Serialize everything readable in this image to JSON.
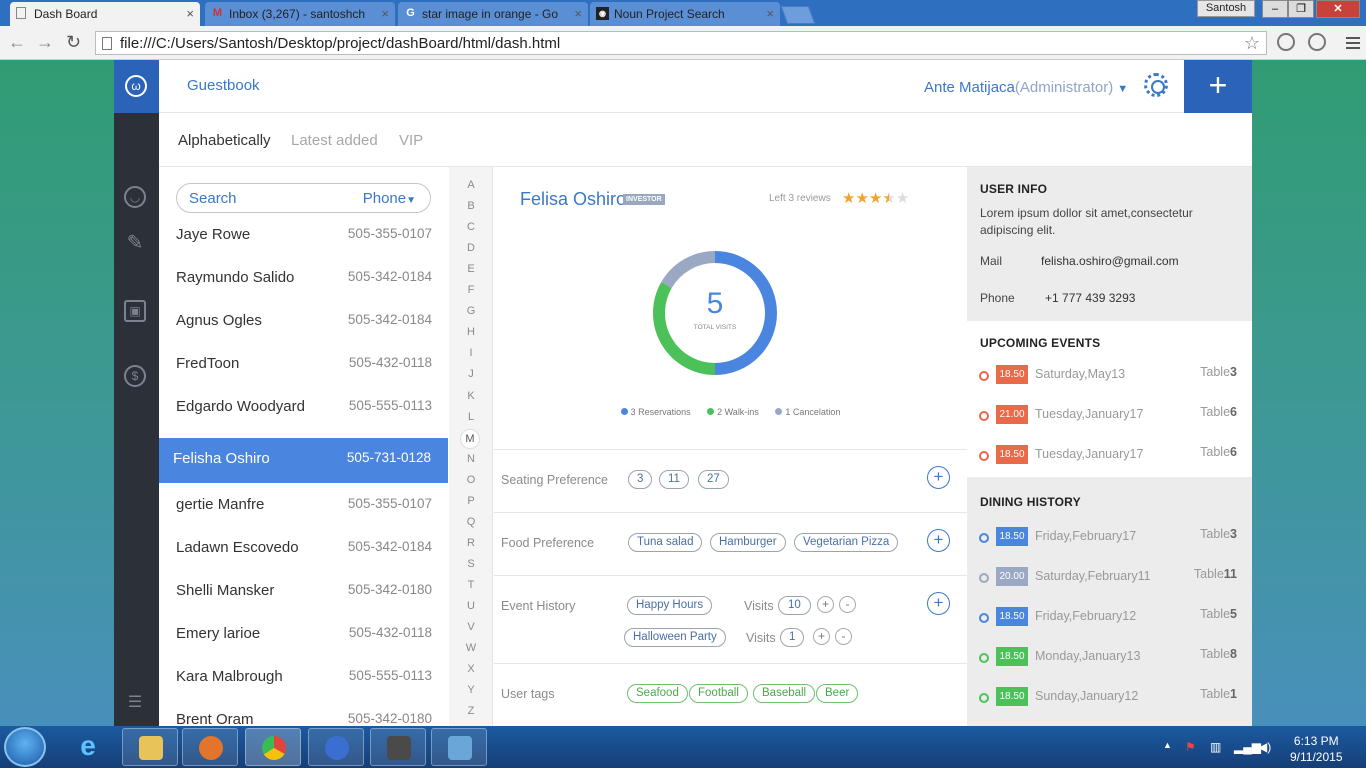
{
  "browser": {
    "tabs": [
      {
        "title": "Dash Board",
        "favicon": "page-icon"
      },
      {
        "title": "Inbox (3,267) - santoshch",
        "favicon": "gmail-icon"
      },
      {
        "title": "star image in orange - Go",
        "favicon": "google-icon"
      },
      {
        "title": "Noun Project Search",
        "favicon": "noun-project-icon"
      }
    ],
    "profile": "Santosh",
    "url": "file:///C:/Users/Santosh/Desktop/project/dashBoard/html/dash.html"
  },
  "header": {
    "section": "Guestbook",
    "user_name": "Ante Matijaca",
    "user_role": "(Administrator)"
  },
  "filters": [
    "Alphabetically",
    "Latest added",
    "VIP"
  ],
  "search": {
    "placeholder": "Search",
    "field": "Phone"
  },
  "guests": [
    {
      "name": "Jaye Rowe",
      "phone": "505-355-0107"
    },
    {
      "name": "Raymundo Salido",
      "phone": "505-342-0184"
    },
    {
      "name": "Agnus Ogles",
      "phone": "505-342-0184"
    },
    {
      "name": "FredToon",
      "phone": "505-432-0118"
    },
    {
      "name": "Edgardo Woodyard",
      "phone": "505-555-0113"
    },
    {
      "name": "Felisha Oshiro",
      "phone": "505-731-0128",
      "selected": true
    },
    {
      "name": "gertie Manfre",
      "phone": "505-355-0107"
    },
    {
      "name": "Ladawn Escovedo",
      "phone": "505-342-0184"
    },
    {
      "name": "Shelli Mansker",
      "phone": "505-342-0180"
    },
    {
      "name": "Emery larioe",
      "phone": "505-432-0118"
    },
    {
      "name": "Kara Malbrough",
      "phone": "505-555-0113"
    },
    {
      "name": "Brent Oram",
      "phone": "505-342-0180"
    }
  ],
  "alphabet": [
    "A",
    "B",
    "C",
    "D",
    "E",
    "F",
    "G",
    "H",
    "I",
    "J",
    "K",
    "L",
    "M",
    "N",
    "O",
    "P",
    "Q",
    "R",
    "S",
    "T",
    "U",
    "V",
    "W",
    "X",
    "Y",
    "Z"
  ],
  "alphabet_active": "M",
  "profile": {
    "name": "Felisa Oshiro",
    "badge": "INVESTOR",
    "reviews": "Left 3 reviews",
    "rating": 3.5,
    "rating_max": 5,
    "visits_total": "5",
    "visits_label": "TOTAL VISITS",
    "legend": [
      {
        "label": "3 Reservations",
        "count": 3,
        "color": "#4a86e0"
      },
      {
        "label": "2 Walk-ins",
        "count": 2,
        "color": "#4cc15a"
      },
      {
        "label": "1 Cancelation",
        "count": 1,
        "color": "#9aa8c4"
      }
    ],
    "seating_label": "Seating Preference",
    "seating": [
      "3",
      "11",
      "27"
    ],
    "food_label": "Food Preference",
    "food": [
      "Tuna salad",
      "Hamburger",
      "Vegetarian Pizza"
    ],
    "event_label": "Event History",
    "events": [
      {
        "name": "Happy Hours",
        "visits_label": "Visits",
        "visits": "10"
      },
      {
        "name": "Halloween Party",
        "visits_label": "Visits",
        "visits": "1"
      }
    ],
    "tags_label": "User tags",
    "tags": [
      "Seafood",
      "Football",
      "Baseball",
      "Beer"
    ]
  },
  "user_info": {
    "title": "USER INFO",
    "description": "Lorem ipsum dollor sit amet,consectetur adipiscing elit.",
    "mail_label": "Mail",
    "mail": "felisha.oshiro@gmail.com",
    "phone_label": "Phone",
    "phone": "+1 777 439 3293"
  },
  "upcoming": {
    "title": "UPCOMING EVENTS",
    "items": [
      {
        "time": "18.50",
        "date": "Saturday,May13",
        "table_label": "Table",
        "table": "3",
        "color": "#e86a4a"
      },
      {
        "time": "21.00",
        "date": "Tuesday,January17",
        "table_label": "Table",
        "table": "6",
        "color": "#e86a4a"
      },
      {
        "time": "18.50",
        "date": "Tuesday,January17",
        "table_label": "Table",
        "table": "6",
        "color": "#e86a4a"
      }
    ]
  },
  "dining": {
    "title": "DINING HISTORY",
    "items": [
      {
        "time": "18.50",
        "date": "Friday,February17",
        "table_label": "Table",
        "table": "3",
        "color": "#4a86e0"
      },
      {
        "time": "20.00",
        "date": "Saturday,February11",
        "table_label": "Table",
        "table": "11",
        "color": "#9aa8c4"
      },
      {
        "time": "18.50",
        "date": "Friday,February12",
        "table_label": "Table",
        "table": "5",
        "color": "#4a86e0"
      },
      {
        "time": "18.50",
        "date": "Monday,January13",
        "table_label": "Table",
        "table": "8",
        "color": "#4cc15a"
      },
      {
        "time": "18.50",
        "date": "Sunday,January12",
        "table_label": "Table",
        "table": "1",
        "color": "#4cc15a"
      }
    ]
  },
  "taskbar": {
    "time": "6:13 PM",
    "date": "9/11/2015"
  }
}
